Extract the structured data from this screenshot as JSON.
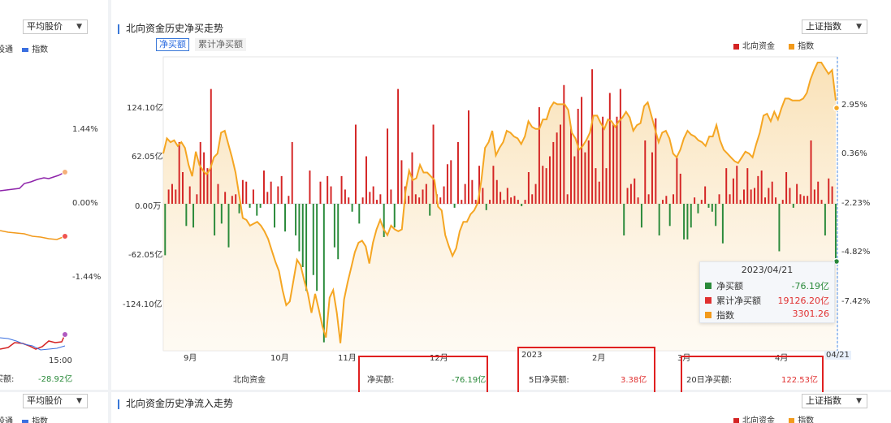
{
  "left_panel": {
    "select_top": "平均股价",
    "legend_top": [
      "设通",
      "指数"
    ],
    "y_labels": [
      "1.44%",
      "0.00%",
      "-1.44%"
    ],
    "time_label": "15:00",
    "footer_label": "买额:",
    "footer_value": "-28.92亿",
    "select_bottom": "平均股价",
    "legend_bottom": [
      "设通",
      "指数"
    ]
  },
  "main_panel": {
    "title": "北向资金历史净买走势",
    "index_select": "上证指数",
    "tabs": [
      "净买额",
      "累计净买额"
    ],
    "legend": [
      {
        "label": "北向资金",
        "color": "#d42424"
      },
      {
        "label": "指数",
        "color": "#f29a1c"
      }
    ],
    "y_left": [
      "124.10亿",
      "62.05亿",
      "0.00万",
      "-62.05亿",
      "-124.10亿"
    ],
    "y_right": [
      "2.95%",
      "0.36%",
      "-2.23%",
      "-4.82%",
      "-7.42%"
    ],
    "x_labels": [
      "9月",
      "10月",
      "11月",
      "12月",
      "2023",
      "2月",
      "3月",
      "4月",
      "04/21"
    ],
    "footer": {
      "series_label": "北向资金",
      "net_label": "净买额:",
      "net_value": "-76.19亿",
      "d5_label": "5日净买额:",
      "d5_value": "3.38亿",
      "d20_label": "20日净买额:",
      "d20_value": "122.53亿"
    },
    "tooltip": {
      "date": "2023/04/21",
      "rows": [
        {
          "label": "净买额",
          "value": "-76.19亿",
          "color": "#2a8a3a"
        },
        {
          "label": "累计净买额",
          "value": "19126.20亿",
          "color": "#e03030"
        },
        {
          "label": "指数",
          "value": "3301.26",
          "color": "#f29a1c"
        }
      ]
    }
  },
  "bottom_panel": {
    "title": "北向资金历史净流入走势",
    "index_select": "上证指数",
    "legend": [
      "北向资金",
      "指数"
    ]
  },
  "chart_data": {
    "type": "bar",
    "title": "北向资金历史净买走势",
    "ylabel": "",
    "ylim": [
      -186.15,
      186.15
    ],
    "y2lim": [
      -10.0,
      5.5
    ],
    "x_start": "2022-08-22",
    "x_end": "2023-04-21",
    "series": [
      {
        "name": "北向资金",
        "unit": "亿",
        "values": [
          -65,
          18,
          25,
          18,
          78,
          40,
          -28,
          22,
          -30,
          12,
          78,
          65,
          45,
          145,
          -40,
          25,
          -25,
          15,
          -55,
          10,
          12,
          -12,
          30,
          28,
          -5,
          18,
          -15,
          -5,
          42,
          15,
          28,
          -30,
          22,
          35,
          -35,
          10,
          78,
          -40,
          -60,
          -80,
          -110,
          42,
          -90,
          -110,
          28,
          -175,
          35,
          22,
          -55,
          -70,
          35,
          18,
          8,
          -10,
          100,
          -25,
          8,
          60,
          15,
          22,
          5,
          12,
          -42,
          95,
          18,
          -30,
          145,
          55,
          22,
          10,
          65,
          12,
          8,
          18,
          25,
          -15,
          100,
          12,
          8,
          22,
          50,
          55,
          -5,
          78,
          5,
          25,
          118,
          30,
          5,
          48,
          20,
          -8,
          5,
          48,
          30,
          15,
          5,
          20,
          8,
          10,
          5,
          -3,
          5,
          40,
          12,
          25,
          122,
          48,
          45,
          60,
          78,
          90,
          100,
          150,
          12,
          95,
          60,
          120,
          135,
          65,
          80,
          170,
          45,
          28,
          110,
          45,
          140,
          100,
          110,
          145,
          -40,
          20,
          25,
          32,
          8,
          -30,
          80,
          12,
          65,
          108,
          -40,
          5,
          10,
          -28,
          12,
          58,
          38,
          -45,
          -45,
          -30,
          8,
          -12,
          5,
          22,
          -5,
          -10,
          -28,
          12,
          -50,
          45,
          12,
          32,
          48,
          5,
          18,
          45,
          18,
          20,
          35,
          42,
          8,
          20,
          28,
          8,
          -60,
          5,
          40,
          20,
          -5,
          25,
          12,
          10,
          10,
          80,
          18,
          28,
          5,
          -40,
          32,
          22,
          -76.19
        ]
      },
      {
        "name": "指数",
        "unit": "%",
        "values": [
          0.4,
          1.2,
          1.0,
          1.1,
          0.8,
          1.0,
          0.7,
          -0.2,
          -0.8,
          0.5,
          -0.2,
          -0.5,
          -0.7,
          -0.4,
          0.2,
          0.4,
          1.5,
          1.6,
          0.9,
          0.2,
          -0.6,
          -1.8,
          -3.0,
          -3.1,
          -3.4,
          -3.3,
          -3.2,
          -3.4,
          -3.7,
          -4.1,
          -4.7,
          -5.3,
          -5.8,
          -6.8,
          -7.6,
          -7.4,
          -6.3,
          -5.2,
          -5.5,
          -6.3,
          -7.0,
          -8.0,
          -7.0,
          -7.8,
          -8.7,
          -9.3,
          -7.2,
          -6.8,
          -8.0,
          -9.6,
          -7.3,
          -6.4,
          -5.6,
          -4.8,
          -4.3,
          -4.2,
          -4.5,
          -5.4,
          -4.3,
          -3.6,
          -3.1,
          -3.6,
          -3.9,
          -3.4,
          -3.6,
          -3.7,
          -3.6,
          -1.6,
          -0.5,
          -1.0,
          -0.9,
          -0.2,
          -0.6,
          -0.6,
          -0.8,
          -1.0,
          -2.4,
          -2.6,
          -3.9,
          -4.5,
          -5.0,
          -4.6,
          -3.7,
          -3.2,
          -3.2,
          -2.8,
          -2.6,
          -2.2,
          -1.0,
          0.7,
          1.0,
          1.6,
          0.3,
          0.7,
          1.0,
          1.6,
          1.5,
          1.3,
          1.2,
          0.9,
          1.3,
          2.1,
          1.8,
          1.7,
          1.7,
          2.2,
          2.2,
          2.8,
          3.1,
          3.0,
          3.0,
          3.0,
          2.7,
          1.5,
          1.2,
          0.6,
          0.8,
          1.1,
          1.5,
          2.4,
          2.4,
          2.0,
          1.7,
          2.2,
          2.1,
          1.8,
          2.1,
          2.3,
          2.6,
          2.3,
          1.6,
          1.9,
          2.0,
          2.9,
          3.1,
          2.4,
          1.7,
          1.0,
          1.5,
          1.6,
          1.2,
          0.4,
          0.2,
          0.6,
          1.2,
          1.6,
          1.4,
          1.3,
          1.1,
          1.0,
          0.8,
          1.3,
          1.3,
          1.9,
          1.1,
          0.6,
          0.4,
          0.2,
          0.0,
          -0.1,
          0.2,
          0.5,
          0.4,
          0.2,
          0.9,
          1.5,
          2.4,
          2.5,
          2.1,
          2.6,
          2.2,
          2.8,
          3.3,
          3.3,
          3.2,
          3.2,
          3.2,
          3.3,
          3.6,
          4.3,
          4.8,
          5.2,
          5.2,
          4.9,
          4.6,
          4.8,
          3.2
        ]
      }
    ]
  }
}
